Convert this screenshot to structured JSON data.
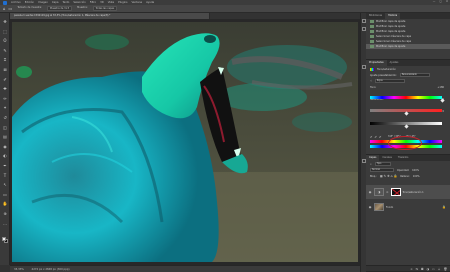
{
  "menubar": {
    "items": [
      "Archivo",
      "Edición",
      "Imagen",
      "Capa",
      "Texto",
      "Selección",
      "Filtro",
      "3D",
      "Vista",
      "Plugins",
      "Ventana",
      "Ayuda"
    ],
    "controls": [
      "—",
      "▢",
      "✕"
    ]
  },
  "optionsbar": {
    "items": [
      "⌂",
      "▭",
      "Tamaño de muestra:",
      "Muestra de 3×3",
      "Muestra:",
      "Todas las capas"
    ]
  },
  "document": {
    "tab_title": "pexels-m-venter-1592119.jpg al 33,3% (Tono/saturación 1, Máscara de capa/8) *",
    "zoom_status": "33,33%",
    "dimensions": "4272 px x 2848 px (300 ppp)"
  },
  "toolbar": {
    "tools": [
      "move-tool",
      "marquee-tool",
      "lasso-tool",
      "quick-select-tool",
      "crop-tool",
      "frame-tool",
      "eyedropper-tool",
      "healing-tool",
      "brush-tool",
      "stamp-tool",
      "history-brush-tool",
      "eraser-tool",
      "gradient-tool",
      "blur-tool",
      "dodge-tool",
      "pen-tool",
      "type-tool",
      "path-select-tool",
      "shape-tool",
      "hand-tool",
      "zoom-tool",
      "more-tools"
    ],
    "glyphs": [
      "✥",
      "⬚",
      "ʘ",
      "✎",
      "⌗",
      "⊠",
      "✐",
      "✚",
      "✏",
      "✦",
      "↺",
      "◫",
      "▤",
      "◉",
      "◐",
      "✒",
      "T",
      "↖",
      "▭",
      "✋",
      "⊕",
      "…"
    ],
    "fg_color": "#eeeeee",
    "bg_color": "#111111"
  },
  "history": {
    "tabs": [
      "Bibliotecas",
      "Historia"
    ],
    "active_tab": 1,
    "items": [
      "Modificar capa de ajuste",
      "Modificar capa de ajuste",
      "Modificar capa de ajuste",
      "Seleccionar máscara de capa",
      "Seleccionar máscara de capa",
      "Modificar capa de ajuste"
    ],
    "selected_index": 5
  },
  "properties": {
    "tabs": [
      "Propiedades",
      "Ajustes"
    ],
    "active_tab": 0,
    "header": "Tono/saturación",
    "preset_label": "Ajuste preestablecido:",
    "preset_value": "Personalizado",
    "channel_value": "Rojos",
    "hue_label": "Tono:",
    "hue_value": "+180",
    "saturation_label": "Saturación:",
    "saturation_value": "0",
    "lightness_label": "Luminosidad:",
    "lightness_value": "0",
    "colorize_label": "Colorear",
    "range_values": [
      "315° / 345°",
      "15° \\ 45°"
    ],
    "hue_slider_fraction": 1.0,
    "saturation_slider_fraction": 0.5,
    "lightness_slider_fraction": 0.5,
    "highlight_color": "#c8202a"
  },
  "layers": {
    "tabs": [
      "Capas",
      "Canales",
      "Trazados"
    ],
    "active_tab": 0,
    "search_label": "Tipo",
    "blend_mode": "Normal",
    "opacity_label": "Opacidad:",
    "opacity_value": "100%",
    "lock_label": "Bloq.:",
    "fill_label": "Relleno:",
    "fill_value": "100%",
    "items": [
      {
        "name": "Tono/saturación 1",
        "type": "adjustment"
      },
      {
        "name": "Fondo",
        "type": "image"
      }
    ],
    "footer_icons": [
      "link-icon",
      "fx-icon",
      "mask-icon",
      "adjustment-icon",
      "group-icon",
      "new-layer-icon",
      "trash-icon"
    ],
    "footer_glyphs": [
      "∞",
      "fx",
      "◘",
      "◑",
      "▭",
      "＋",
      "🗑"
    ]
  }
}
